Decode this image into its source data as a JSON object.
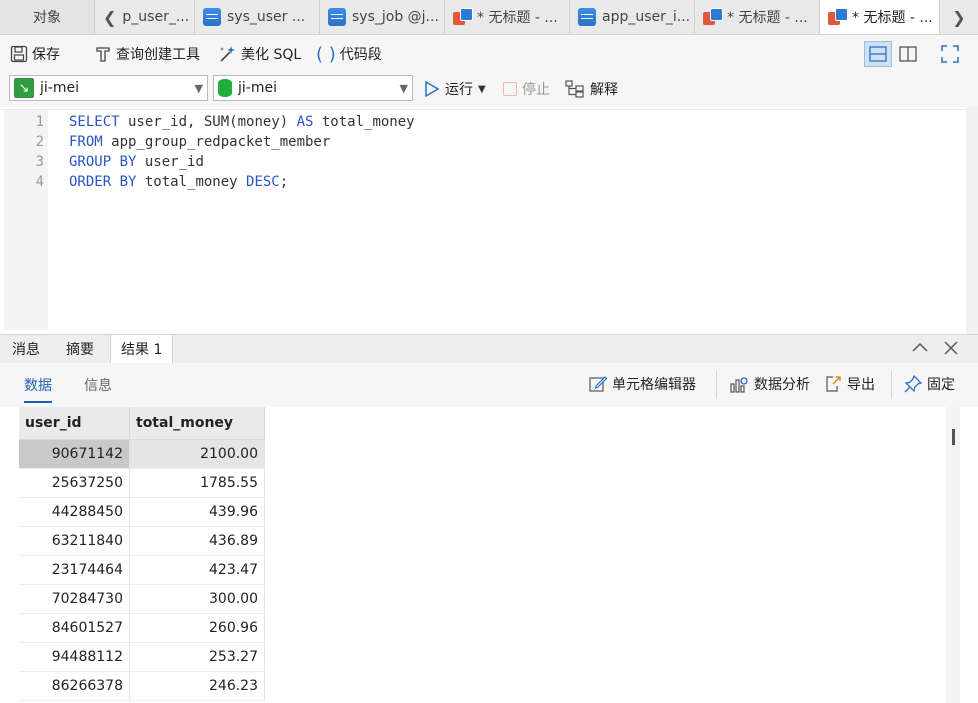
{
  "tabs": [
    {
      "label": "对象"
    },
    {
      "label": "p_user_..."
    },
    {
      "label": "sys_user ..."
    },
    {
      "label": "sys_job @j..."
    },
    {
      "label": "* 无标题 - ..."
    },
    {
      "label": "app_user_i..."
    },
    {
      "label": "* 无标题 - ..."
    },
    {
      "label": "* 无标题 - ..."
    }
  ],
  "toolbar": {
    "save": "保存",
    "query_builder": "查询创建工具",
    "beautify": "美化 SQL",
    "snippet": "代码段"
  },
  "connection": {
    "connection_name": "ji-mei",
    "database_name": "ji-mei",
    "run": "运行",
    "stop": "停止",
    "explain": "解释"
  },
  "editor": {
    "line_numbers": [
      "1",
      "2",
      "3",
      "4"
    ],
    "lines": [
      [
        {
          "t": "SELECT",
          "k": true
        },
        {
          "t": " user_id, SUM(money) ",
          "k": false
        },
        {
          "t": "AS",
          "k": true
        },
        {
          "t": " total_money",
          "k": false
        }
      ],
      [
        {
          "t": "FROM",
          "k": true
        },
        {
          "t": " app_group_redpacket_member",
          "k": false
        }
      ],
      [
        {
          "t": "GROUP BY",
          "k": true
        },
        {
          "t": " user_id",
          "k": false
        }
      ],
      [
        {
          "t": "ORDER BY",
          "k": true
        },
        {
          "t": " total_money ",
          "k": false
        },
        {
          "t": "DESC",
          "k": true
        },
        {
          "t": ";",
          "k": false
        }
      ]
    ]
  },
  "results": {
    "tabs": [
      "消息",
      "摘要",
      "结果 1"
    ],
    "subtabs": [
      "数据",
      "信息"
    ],
    "actions": {
      "cell_editor": "单元格编辑器",
      "analysis": "数据分析",
      "export": "导出",
      "pin": "固定"
    },
    "columns": [
      "user_id",
      "total_money"
    ],
    "rows": [
      [
        "90671142",
        "2100.00"
      ],
      [
        "25637250",
        "1785.55"
      ],
      [
        "44288450",
        "439.96"
      ],
      [
        "63211840",
        "436.89"
      ],
      [
        "23174464",
        "423.47"
      ],
      [
        "70284730",
        "300.00"
      ],
      [
        "84601527",
        "260.96"
      ],
      [
        "94488112",
        "253.27"
      ],
      [
        "86266378",
        "246.23"
      ]
    ]
  }
}
